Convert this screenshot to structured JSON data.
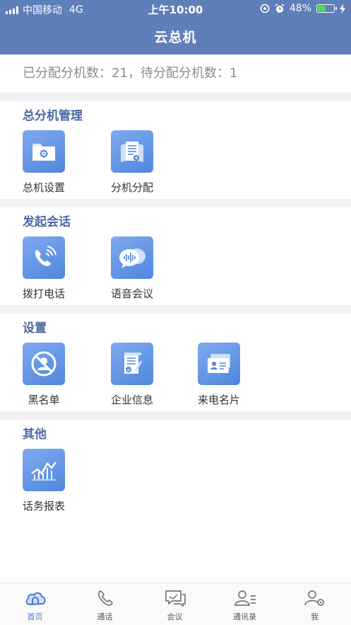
{
  "status_bar": {
    "carrier": "中国移动",
    "network": "4G",
    "time": "上午10:00",
    "battery": "48%",
    "battery_level": 0.48
  },
  "header": {
    "title": "云总机"
  },
  "summary": {
    "text": "已分配分机数：21，待分配分机数：1"
  },
  "sections": [
    {
      "title": "总分机管理",
      "items": [
        {
          "label": "总机设置",
          "icon": "folder-gear-icon"
        },
        {
          "label": "分机分配",
          "icon": "documents-gear-icon"
        }
      ]
    },
    {
      "title": "发起会话",
      "items": [
        {
          "label": "拨打电话",
          "icon": "phone-call-icon"
        },
        {
          "label": "语音会议",
          "icon": "voice-chat-icon"
        }
      ]
    },
    {
      "title": "设置",
      "items": [
        {
          "label": "黑名单",
          "icon": "blocked-user-icon"
        },
        {
          "label": "企业信息",
          "icon": "scroll-document-icon"
        },
        {
          "label": "来电名片",
          "icon": "contact-card-icon"
        }
      ]
    },
    {
      "title": "其他",
      "items": [
        {
          "label": "话务报表",
          "icon": "line-chart-icon"
        }
      ]
    }
  ],
  "tabs": [
    {
      "label": "首页",
      "icon": "home-cloud-icon",
      "active": true
    },
    {
      "label": "通话",
      "icon": "phone-icon"
    },
    {
      "label": "会议",
      "icon": "meeting-icon"
    },
    {
      "label": "通讯录",
      "icon": "contacts-icon"
    },
    {
      "label": "我",
      "icon": "profile-settings-icon"
    }
  ],
  "colors": {
    "header": "#5f7fb8",
    "section_title": "#4b6aa5",
    "icon_gradient_top": "#7faaf0",
    "icon_gradient_bottom": "#4f86dc",
    "active_tab": "#4b79c8"
  }
}
